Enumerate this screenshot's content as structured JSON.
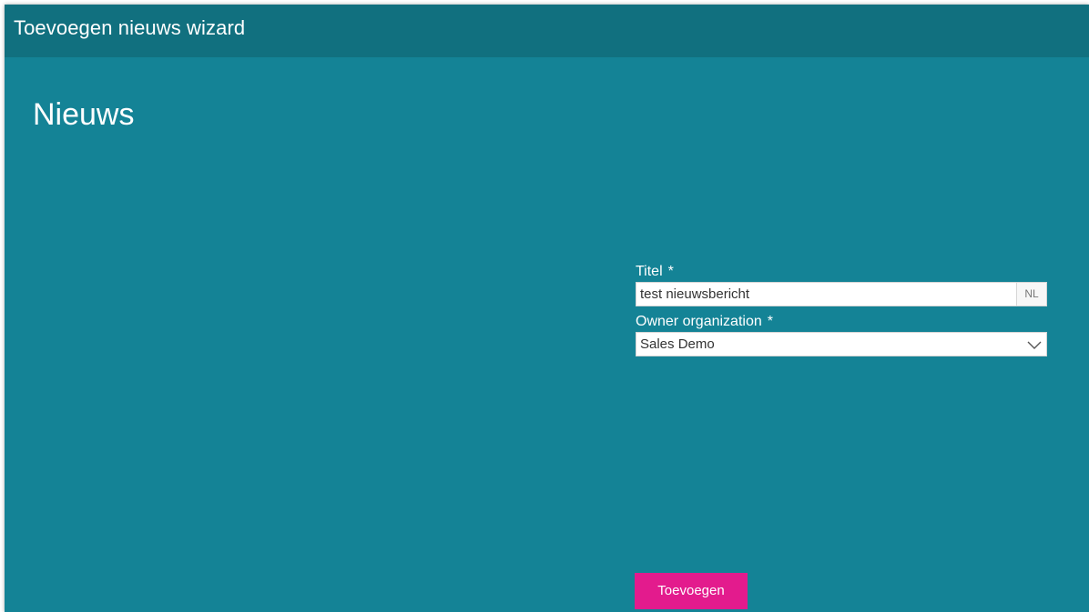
{
  "window": {
    "title": "Toevoegen nieuws wizard"
  },
  "page": {
    "heading": "Nieuws"
  },
  "form": {
    "title_field": {
      "label": "Titel",
      "required_marker": "*",
      "value": "test nieuwsbericht",
      "language": "NL"
    },
    "owner_field": {
      "label": "Owner organization",
      "required_marker": "*",
      "selected": "Sales Demo"
    }
  },
  "actions": {
    "submit_label": "Toevoegen"
  },
  "colors": {
    "background": "#148396",
    "titlebar": "#11707f",
    "accent_button": "#e31b8d"
  },
  "icons": {
    "dropdown": "chevron-down-icon"
  }
}
